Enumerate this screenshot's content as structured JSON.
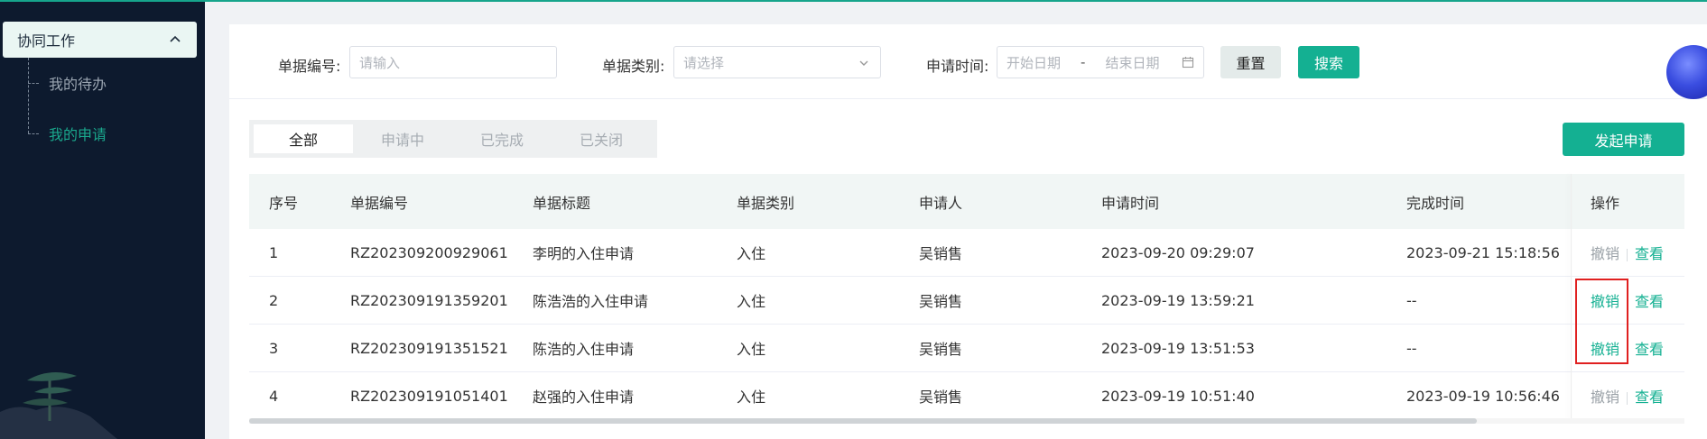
{
  "sidebar": {
    "group_label": "协同工作",
    "items": [
      {
        "label": "我的待办",
        "active": false
      },
      {
        "label": "我的申请",
        "active": true
      }
    ]
  },
  "filters": {
    "doc_no_label": "单据编号:",
    "doc_no_placeholder": "请输入",
    "doc_type_label": "单据类别:",
    "doc_type_placeholder": "请选择",
    "apply_time_label": "申请时间:",
    "start_date_placeholder": "开始日期",
    "date_separator": "-",
    "end_date_placeholder": "结束日期",
    "reset_label": "重置",
    "search_label": "搜索"
  },
  "tabs": [
    "全部",
    "申请中",
    "已完成",
    "已关闭"
  ],
  "active_tab": "全部",
  "new_request_label": "发起申请",
  "table": {
    "headers": [
      "序号",
      "单据编号",
      "单据标题",
      "单据类别",
      "申请人",
      "申请时间",
      "完成时间",
      "操作"
    ],
    "rows": [
      {
        "no": "1",
        "code": "RZ202309200929061",
        "title": "李明的入住申请",
        "type": "入住",
        "applicant": "吴销售",
        "apply_time": "2023-09-20 09:29:07",
        "finish_time": "2023-09-21 15:18:56",
        "cancel": "撤销",
        "view": "查看",
        "cancel_enabled": false
      },
      {
        "no": "2",
        "code": "RZ202309191359201",
        "title": "陈浩浩的入住申请",
        "type": "入住",
        "applicant": "吴销售",
        "apply_time": "2023-09-19 13:59:21",
        "finish_time": "--",
        "cancel": "撤销",
        "view": "查看",
        "cancel_enabled": true
      },
      {
        "no": "3",
        "code": "RZ202309191351521",
        "title": "陈浩的入住申请",
        "type": "入住",
        "applicant": "吴销售",
        "apply_time": "2023-09-19 13:51:53",
        "finish_time": "--",
        "cancel": "撤销",
        "view": "查看",
        "cancel_enabled": true
      },
      {
        "no": "4",
        "code": "RZ202309191051401",
        "title": "赵强的入住申请",
        "type": "入住",
        "applicant": "吴销售",
        "apply_time": "2023-09-19 10:51:40",
        "finish_time": "2023-09-19 10:56:46",
        "cancel": "撤销",
        "view": "查看",
        "cancel_enabled": false
      }
    ]
  },
  "colors": {
    "accent": "#14b092",
    "sidebar_bg": "#0d1a2e",
    "highlight": "#e02020"
  }
}
